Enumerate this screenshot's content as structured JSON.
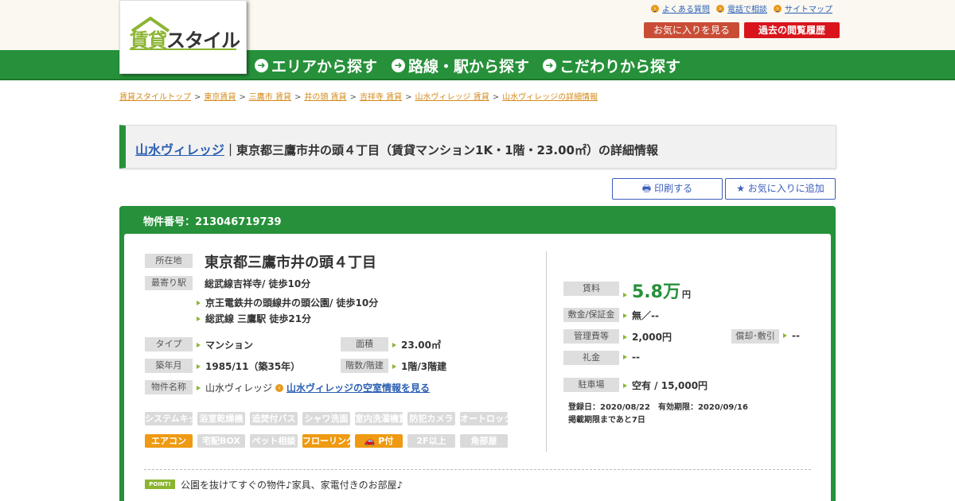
{
  "header": {
    "logo_text_1": "賃貸",
    "logo_text_2": "スタイル",
    "util_links": [
      {
        "label": "よくある質問"
      },
      {
        "label": "電話で相談"
      },
      {
        "label": "サイトマップ"
      }
    ],
    "favorites_button": "お気に入りを見る",
    "history_button": "過去の閲覧履歴"
  },
  "nav": {
    "items": [
      {
        "label": "エリアから探す"
      },
      {
        "label": "路線・駅から探す"
      },
      {
        "label": "こだわりから探す"
      }
    ]
  },
  "breadcrumb": [
    "賃貸スタイルトップ",
    "東京賃貸",
    "三鷹市 賃貸",
    "井の頭 賃貸",
    "吉祥寺 賃貸",
    "山水ヴィレッジ 賃貸",
    "山水ヴィレッジの詳細情報"
  ],
  "title": {
    "link": "山水ヴィレッジ",
    "rest": "｜東京都三鷹市井の頭４丁目（賃貸マンション1K・1階・23.00㎡）の詳細情報"
  },
  "actions": {
    "print": "印刷する",
    "add_favorite": "お気に入りに追加"
  },
  "property": {
    "number_label": "物件番号：213046719739",
    "address_label": "所在地",
    "address": "東京都三鷹市井の頭４丁目",
    "station_label": "最寄り駅",
    "stations": [
      "総武線吉祥寺/ 徒歩10分",
      "京王電鉄井の頭線井の頭公園/ 徒歩10分",
      "総武線 三鷹駅 徒歩21分"
    ],
    "type_label": "タイプ",
    "type": "マンション",
    "area_label": "面積",
    "area": "23.00㎡",
    "built_label": "築年月",
    "built": "1985/11（築35年）",
    "floor_label": "階数/階建",
    "floor": "1階/3階建",
    "name_label": "物件名称",
    "name": "山水ヴィレッジ",
    "vacancy_link": "山水ヴィレッジの空室情報を見る",
    "rent_label": "賃料",
    "rent_value": "5.8万",
    "rent_unit": "円",
    "deposit_label": "敷金/保証金",
    "deposit": "無／--",
    "mgmt_label": "管理費等",
    "mgmt": "2,000円",
    "depreciation_label": "償却･敷引",
    "depreciation": "--",
    "key_money_label": "礼金",
    "key_money": "--",
    "parking_label": "駐車場",
    "parking": "空有 / 15,000円",
    "registered": "登録日：2020/08/22　有効期限：2020/09/16",
    "remaining": "掲載期限まであと7日",
    "point_badge": "POINT!",
    "point_text": "公園を抜けてすぐの物件♪家具、家電付きのお部屋♪"
  },
  "features": {
    "row1": [
      {
        "label": "システムキッチン",
        "active": false
      },
      {
        "label": "浴室乾燥機",
        "active": false
      },
      {
        "label": "追焚付バス",
        "active": false
      },
      {
        "label": "シャワ洗面",
        "active": false
      },
      {
        "label": "室内洗濯機置場",
        "active": false
      },
      {
        "label": "防犯カメラ",
        "active": false
      },
      {
        "label": "オートロック",
        "active": false
      }
    ],
    "row2": [
      {
        "label": "エアコン",
        "active": true
      },
      {
        "label": "宅配BOX",
        "active": false
      },
      {
        "label": "ペット相談",
        "active": false
      },
      {
        "label": "フローリング",
        "active": true
      },
      {
        "label": "P付",
        "active": true
      },
      {
        "label": "2F以上",
        "active": false
      },
      {
        "label": "角部屋",
        "active": false
      }
    ]
  },
  "colors": {
    "brand_green": "#26913a",
    "accent_orange": "#ef9a12",
    "link_blue": "#2b5fb3",
    "history_red": "#d9141b"
  }
}
